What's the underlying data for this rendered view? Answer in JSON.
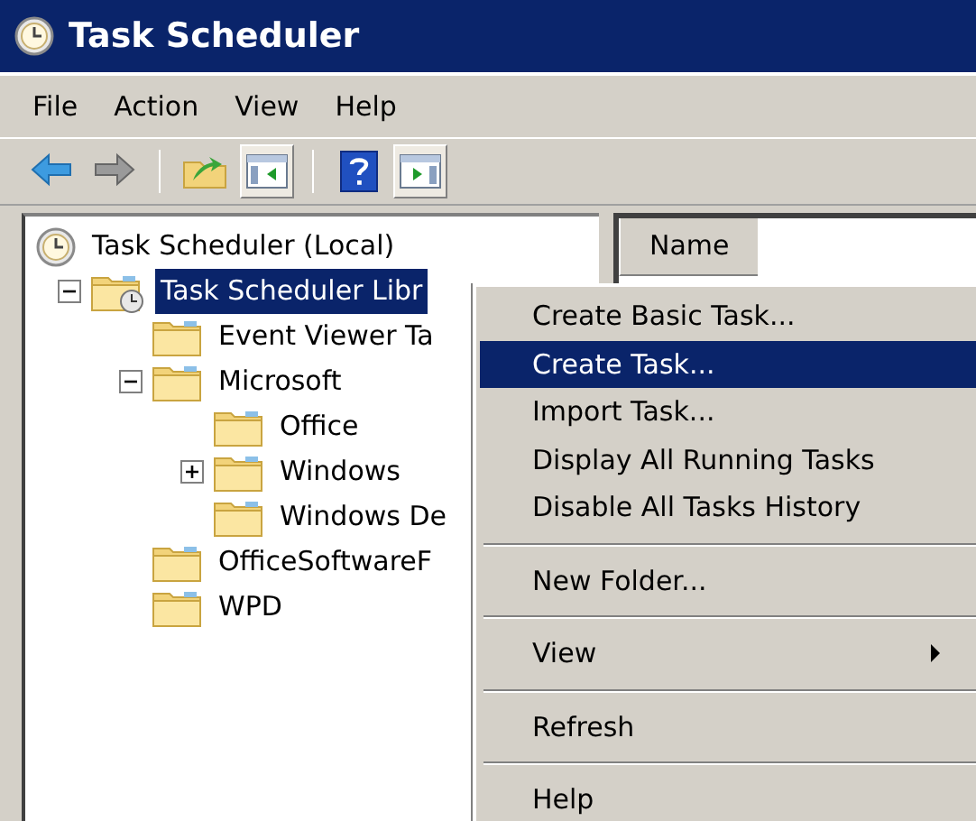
{
  "window": {
    "title": "Task Scheduler"
  },
  "menu_bar": [
    "File",
    "Action",
    "View",
    "Help"
  ],
  "toolbar": [
    {
      "kind": "back",
      "pressed": false
    },
    {
      "kind": "forward",
      "pressed": false
    },
    {
      "kind": "up",
      "pressed": false
    },
    {
      "kind": "console-tree",
      "pressed": true
    },
    {
      "kind": "help",
      "pressed": false
    },
    {
      "kind": "action-pane",
      "pressed": true
    }
  ],
  "tree": [
    {
      "label": "Task Scheduler (Local)",
      "kind": "computer",
      "selected": false,
      "children": [
        {
          "label": "Task Scheduler Libr",
          "kind": "library",
          "selected": true,
          "expanded": true,
          "children": [
            {
              "label": "Event Viewer Ta",
              "kind": "folder",
              "selected": false
            },
            {
              "label": "Microsoft",
              "kind": "folder",
              "selected": false,
              "expanded": true,
              "children": [
                {
                  "label": "Office",
                  "kind": "folder",
                  "selected": false
                },
                {
                  "label": "Windows",
                  "kind": "folder",
                  "selected": false,
                  "expanded": false
                },
                {
                  "label": "Windows De",
                  "kind": "folder",
                  "selected": false
                }
              ]
            },
            {
              "label": "OfficeSoftwareF",
              "kind": "folder",
              "selected": false
            },
            {
              "label": "WPD",
              "kind": "folder",
              "selected": false
            }
          ]
        }
      ]
    }
  ],
  "list_view": {
    "columns": [
      "Name"
    ]
  },
  "context_menu": [
    [
      {
        "label": "Create Basic Task...",
        "selected": false,
        "submenu": false
      },
      {
        "label": "Create Task...",
        "selected": true,
        "submenu": false
      },
      {
        "label": "Import Task...",
        "selected": false,
        "submenu": false
      },
      {
        "label": "Display All Running Tasks",
        "selected": false,
        "submenu": false
      },
      {
        "label": "Disable All Tasks History",
        "selected": false,
        "submenu": false
      }
    ],
    [
      {
        "label": "New Folder...",
        "selected": false,
        "submenu": false
      }
    ],
    [
      {
        "label": "View",
        "selected": false,
        "submenu": true
      }
    ],
    [
      {
        "label": "Refresh",
        "selected": false,
        "submenu": false
      }
    ],
    [
      {
        "label": "Help",
        "selected": false,
        "submenu": false
      }
    ]
  ]
}
